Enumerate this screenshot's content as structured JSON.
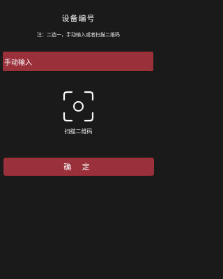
{
  "page": {
    "title": "设备编号",
    "note": "注：二选一，手动输入或者扫描二维码"
  },
  "input": {
    "value": "手动输入"
  },
  "scan": {
    "label": "扫描二维码",
    "icon": "scan-frame-icon"
  },
  "confirm": {
    "label": "确 定"
  },
  "colors": {
    "background": "#1b1a1b",
    "accent": "#9a3039",
    "text": "#ffffff"
  }
}
